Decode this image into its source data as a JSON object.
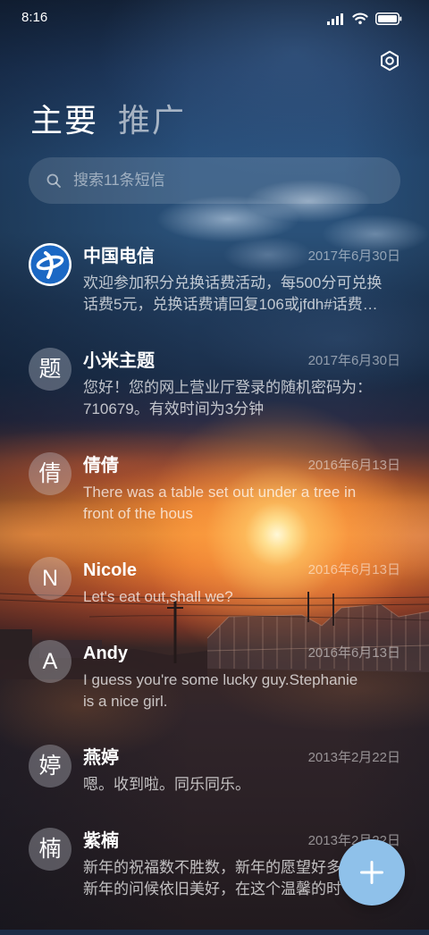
{
  "status_bar": {
    "time": "8:16",
    "icons": [
      "signal-icon",
      "wifi-icon",
      "battery-icon"
    ]
  },
  "header": {
    "settings_icon": "settings-icon",
    "tabs": [
      {
        "label": "主要",
        "active": true
      },
      {
        "label": "推广",
        "active": false
      }
    ]
  },
  "search": {
    "icon": "search-icon",
    "placeholder": "搜索11条短信"
  },
  "conversations": [
    {
      "avatar_icon": "china-telecom-logo",
      "name": "中国电信",
      "date": "2017年6月30日",
      "preview": [
        "欢迎参加积分兑换话费活动，每500分可兑换",
        "话费5元，兑换话费请回复106或jfdh#话费…"
      ]
    },
    {
      "avatar_text": "题",
      "name": "小米主题",
      "date": "2017年6月30日",
      "preview": [
        "您好！您的网上营业厅登录的随机密码为：",
        "710679。有效时间为3分钟"
      ]
    },
    {
      "avatar_text": "倩",
      "name": "倩倩",
      "date": "2016年6月13日",
      "preview": [
        "There was a table set out under a tree in",
        "front of the hous"
      ]
    },
    {
      "avatar_text": "N",
      "name": "Nicole",
      "date": "2016年6月13日",
      "preview": [
        "Let's eat out,shall we?"
      ]
    },
    {
      "avatar_text": "A",
      "name": "Andy",
      "date": "2016年6月13日",
      "preview": [
        "I guess you're some lucky guy.Stephanie",
        "is a nice girl."
      ]
    },
    {
      "avatar_text": "婷",
      "name": "燕婷",
      "date": "2013年2月22日",
      "preview": [
        "嗯。收到啦。同乐同乐。"
      ]
    },
    {
      "avatar_text": "楠",
      "name": "紫楠",
      "date": "2013年2月22日",
      "preview": [
        "新年的祝福数不胜数，新年的愿望好多",
        "新年的问候依旧美好，在这个温馨的时"
      ]
    }
  ],
  "fab": {
    "icon": "plus-icon"
  },
  "colors": {
    "text_primary": "#ffffff",
    "fab": "#8fc1ea",
    "china_telecom_blue": "#1b68c4"
  }
}
